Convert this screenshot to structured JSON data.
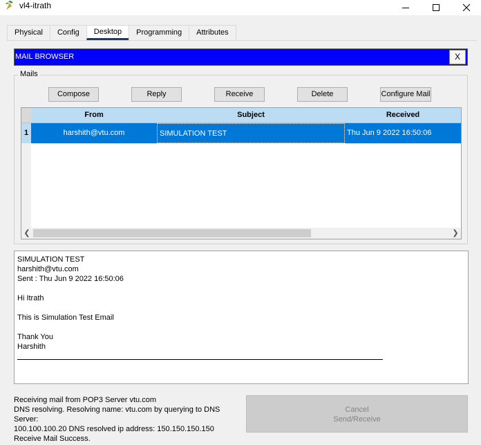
{
  "window": {
    "title": "vl4-itrath"
  },
  "tabs": [
    {
      "label": "Physical"
    },
    {
      "label": "Config"
    },
    {
      "label": "Desktop"
    },
    {
      "label": "Programming"
    },
    {
      "label": "Attributes"
    }
  ],
  "mail_browser": {
    "title": "MAIL BROWSER",
    "close_label": "X"
  },
  "mails_group": {
    "label": "Mails"
  },
  "toolbar": {
    "compose": "Compose",
    "reply": "Reply",
    "receive": "Receive",
    "delete": "Delete",
    "configure": "Configure Mail"
  },
  "table": {
    "columns": [
      "From",
      "Subject",
      "Received"
    ],
    "rows": [
      {
        "num": "1",
        "from": "harshith@vtu.com",
        "subject": "SIMULATION TEST",
        "received": "Thu Jun 9 2022 16:50:06"
      }
    ]
  },
  "message": {
    "subject": "SIMULATION TEST",
    "from": "harshith@vtu.com",
    "sent": "Sent : Thu Jun 9 2022 16:50:06",
    "greeting": "Hi Itrath",
    "body": "This is Simulation Test Email",
    "closing": "Thank You",
    "signature": "Harshith"
  },
  "status": {
    "line1": "Receiving mail from POP3 Server vtu.com",
    "line2": "DNS resolving. Resolving name: vtu.com by querying to DNS Server:",
    "line3": "100.100.100.20  DNS resolved ip address: 150.150.150.150",
    "line4": "Receive Mail Success."
  },
  "cancel_button": {
    "line1": "Cancel",
    "line2": "Send/Receive"
  },
  "colors": {
    "header_blue": "#0000ff",
    "selection": "#0078d7",
    "table_header": "#bcdcf4"
  }
}
